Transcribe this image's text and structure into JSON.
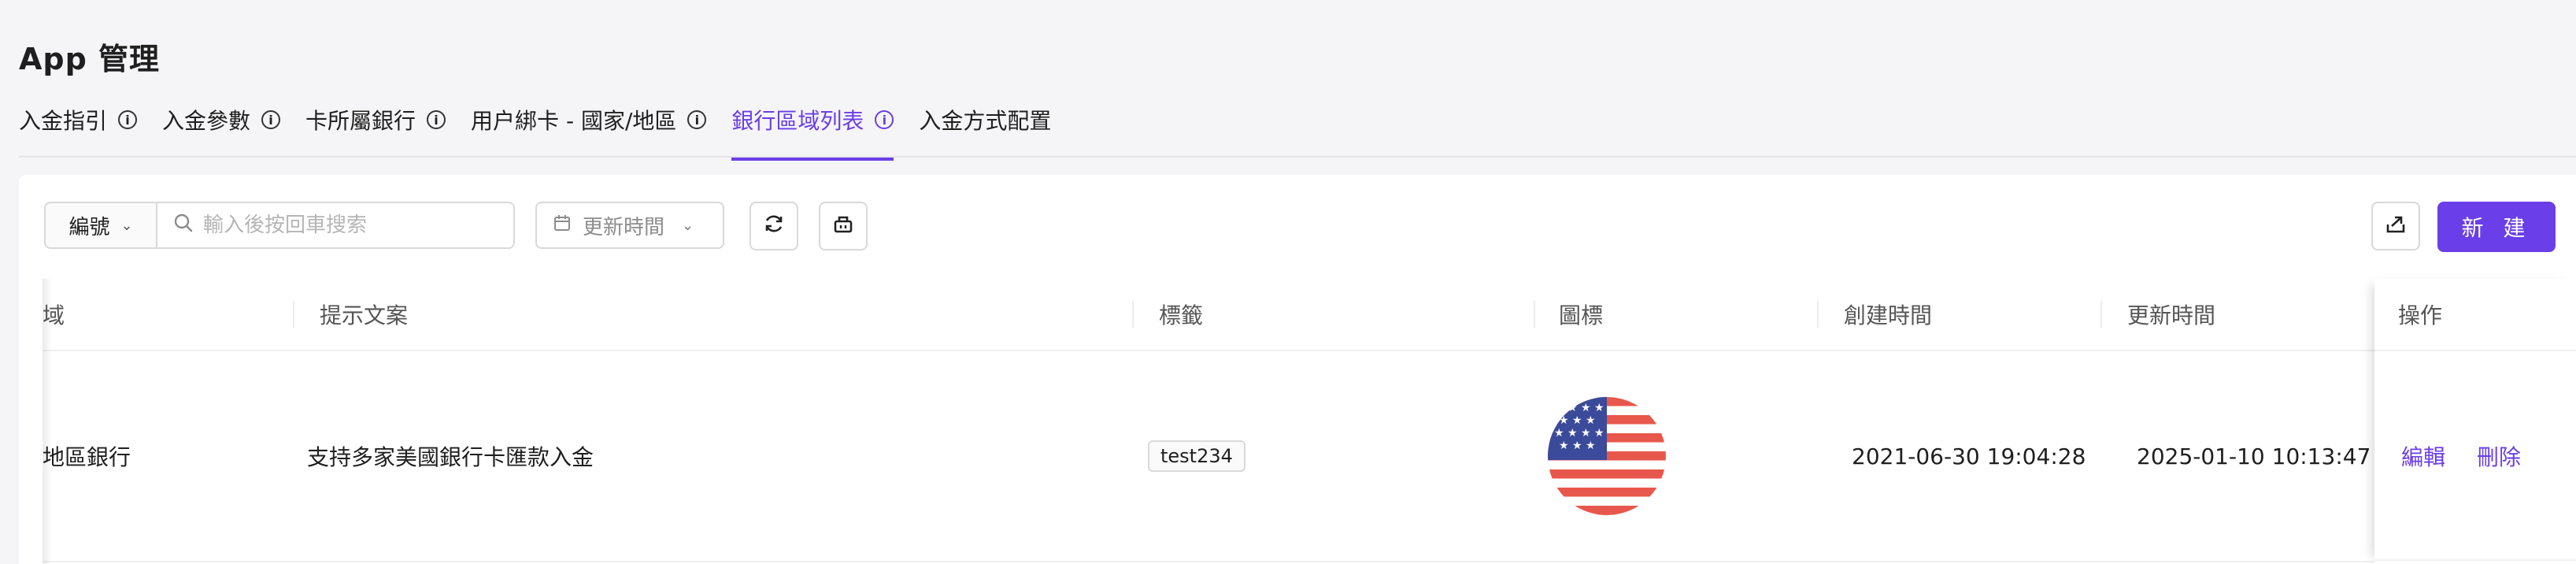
{
  "page": {
    "title": "App 管理"
  },
  "tabs": [
    {
      "label": "入金指引",
      "has_info": true,
      "active": false
    },
    {
      "label": "入金參數",
      "has_info": true,
      "active": false
    },
    {
      "label": "卡所屬銀行",
      "has_info": true,
      "active": false
    },
    {
      "label": "用户綁卡 - 國家/地區",
      "has_info": true,
      "active": false
    },
    {
      "label": "銀行區域列表",
      "has_info": true,
      "active": true
    },
    {
      "label": "入金方式配置",
      "has_info": false,
      "active": false
    }
  ],
  "toolbar": {
    "field_select": "編號",
    "search_placeholder": "輸入後按回車搜索",
    "date_filter": "更新時間",
    "icons": [
      "refresh-icon",
      "clear-filter-icon",
      "export-icon"
    ],
    "new_button": "新 建"
  },
  "table": {
    "columns": [
      "域",
      "提示文案",
      "標籤",
      "圖標",
      "創建時間",
      "更新時間",
      "操作"
    ],
    "rows": [
      {
        "region": "地區銀行",
        "hint_text": "支持多家美國銀行卡匯款入金",
        "tag": "test234",
        "icon": "us-flag-icon",
        "created": "2021-06-30 19:04:28",
        "updated": "2025-01-10 10:13:47",
        "actions": [
          "編輯",
          "刪除"
        ]
      }
    ]
  },
  "colors": {
    "accent": "#6a3ee8",
    "background": "#f5f5f7",
    "panel": "#ffffff"
  }
}
